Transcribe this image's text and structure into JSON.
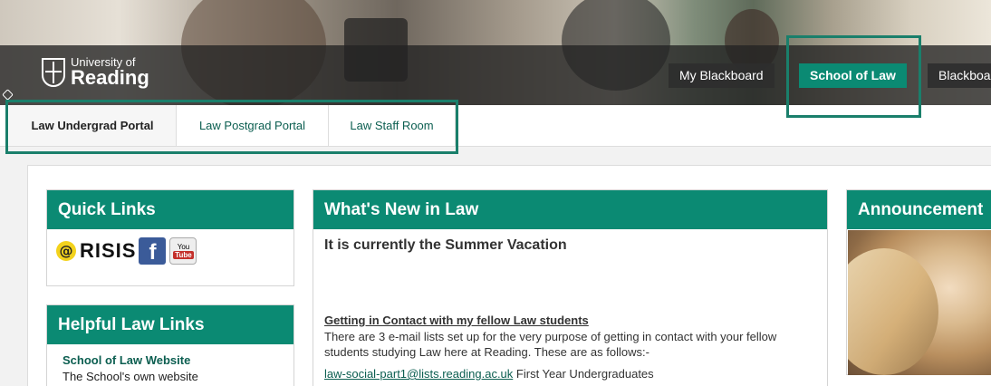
{
  "header": {
    "logo": {
      "line1": "University of",
      "line2": "Reading"
    },
    "tabs": [
      {
        "label": "My Blackboard"
      },
      {
        "label": "School of Law"
      },
      {
        "label": "Blackboa"
      }
    ]
  },
  "portal_tabs": [
    {
      "label": "Law Undergrad Portal"
    },
    {
      "label": "Law Postgrad Portal"
    },
    {
      "label": "Law Staff Room"
    }
  ],
  "quick_links": {
    "title": "Quick Links",
    "icons": {
      "at": "@",
      "risis": "RISIS",
      "facebook": "f",
      "youtube_top": "You",
      "youtube_bottom": "Tube"
    }
  },
  "helpful_links": {
    "title": "Helpful Law Links",
    "items": [
      {
        "link": "School of Law Website",
        "desc": "The School's own website"
      }
    ]
  },
  "whats_new": {
    "title": "What's New in Law",
    "subtitle": "It is currently the Summer Vacation",
    "heading": "Getting in Contact with my fellow Law students",
    "paragraph": "There are 3 e-mail lists set up for the very purpose of getting in contact with your fellow students studying Law here at Reading. These are as follows:-",
    "list": [
      {
        "email": "law-social-part1@lists.reading.ac.uk",
        "desc": "First Year Undergraduates"
      }
    ]
  },
  "announcements": {
    "title": "Announcement"
  },
  "colors": {
    "accent": "#0b8a73",
    "link": "#0b5e50",
    "annotation": "#1a7f6b"
  }
}
